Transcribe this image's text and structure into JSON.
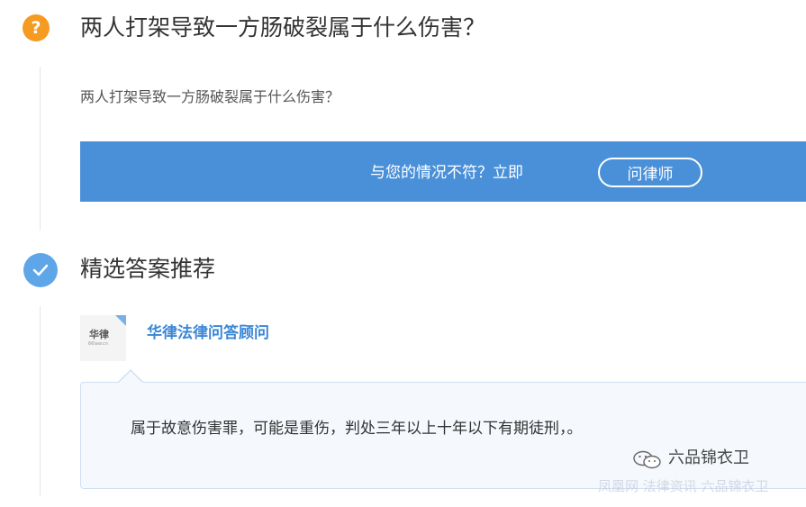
{
  "question": {
    "icon": "question-icon",
    "icon_glyph": "?",
    "title": "两人打架导致一方肠破裂属于什么伤害？",
    "body": "两人打架导致一方肠破裂属于什么伤害？"
  },
  "banner": {
    "text": "与您的情况不符？立即",
    "button_label": "问律师",
    "color": "#4a90d9"
  },
  "answer": {
    "icon": "check-icon",
    "title": "精选答案推荐",
    "avatar_text": "华律",
    "avatar_subtext": "66law.cn",
    "consultant": "华律法律问答顾问",
    "text": "属于故意伤害罪，可能是重伤，判处三年以上十年以下有期徒刑，。"
  },
  "watermark": {
    "icon": "wechat-icon",
    "name": "六品锦衣卫",
    "sub": "凤凰网 法律资讯 六品锦衣卫"
  },
  "colors": {
    "question_icon": "#f59b22",
    "answer_icon": "#5ea6e8",
    "link": "#3a86d6"
  }
}
